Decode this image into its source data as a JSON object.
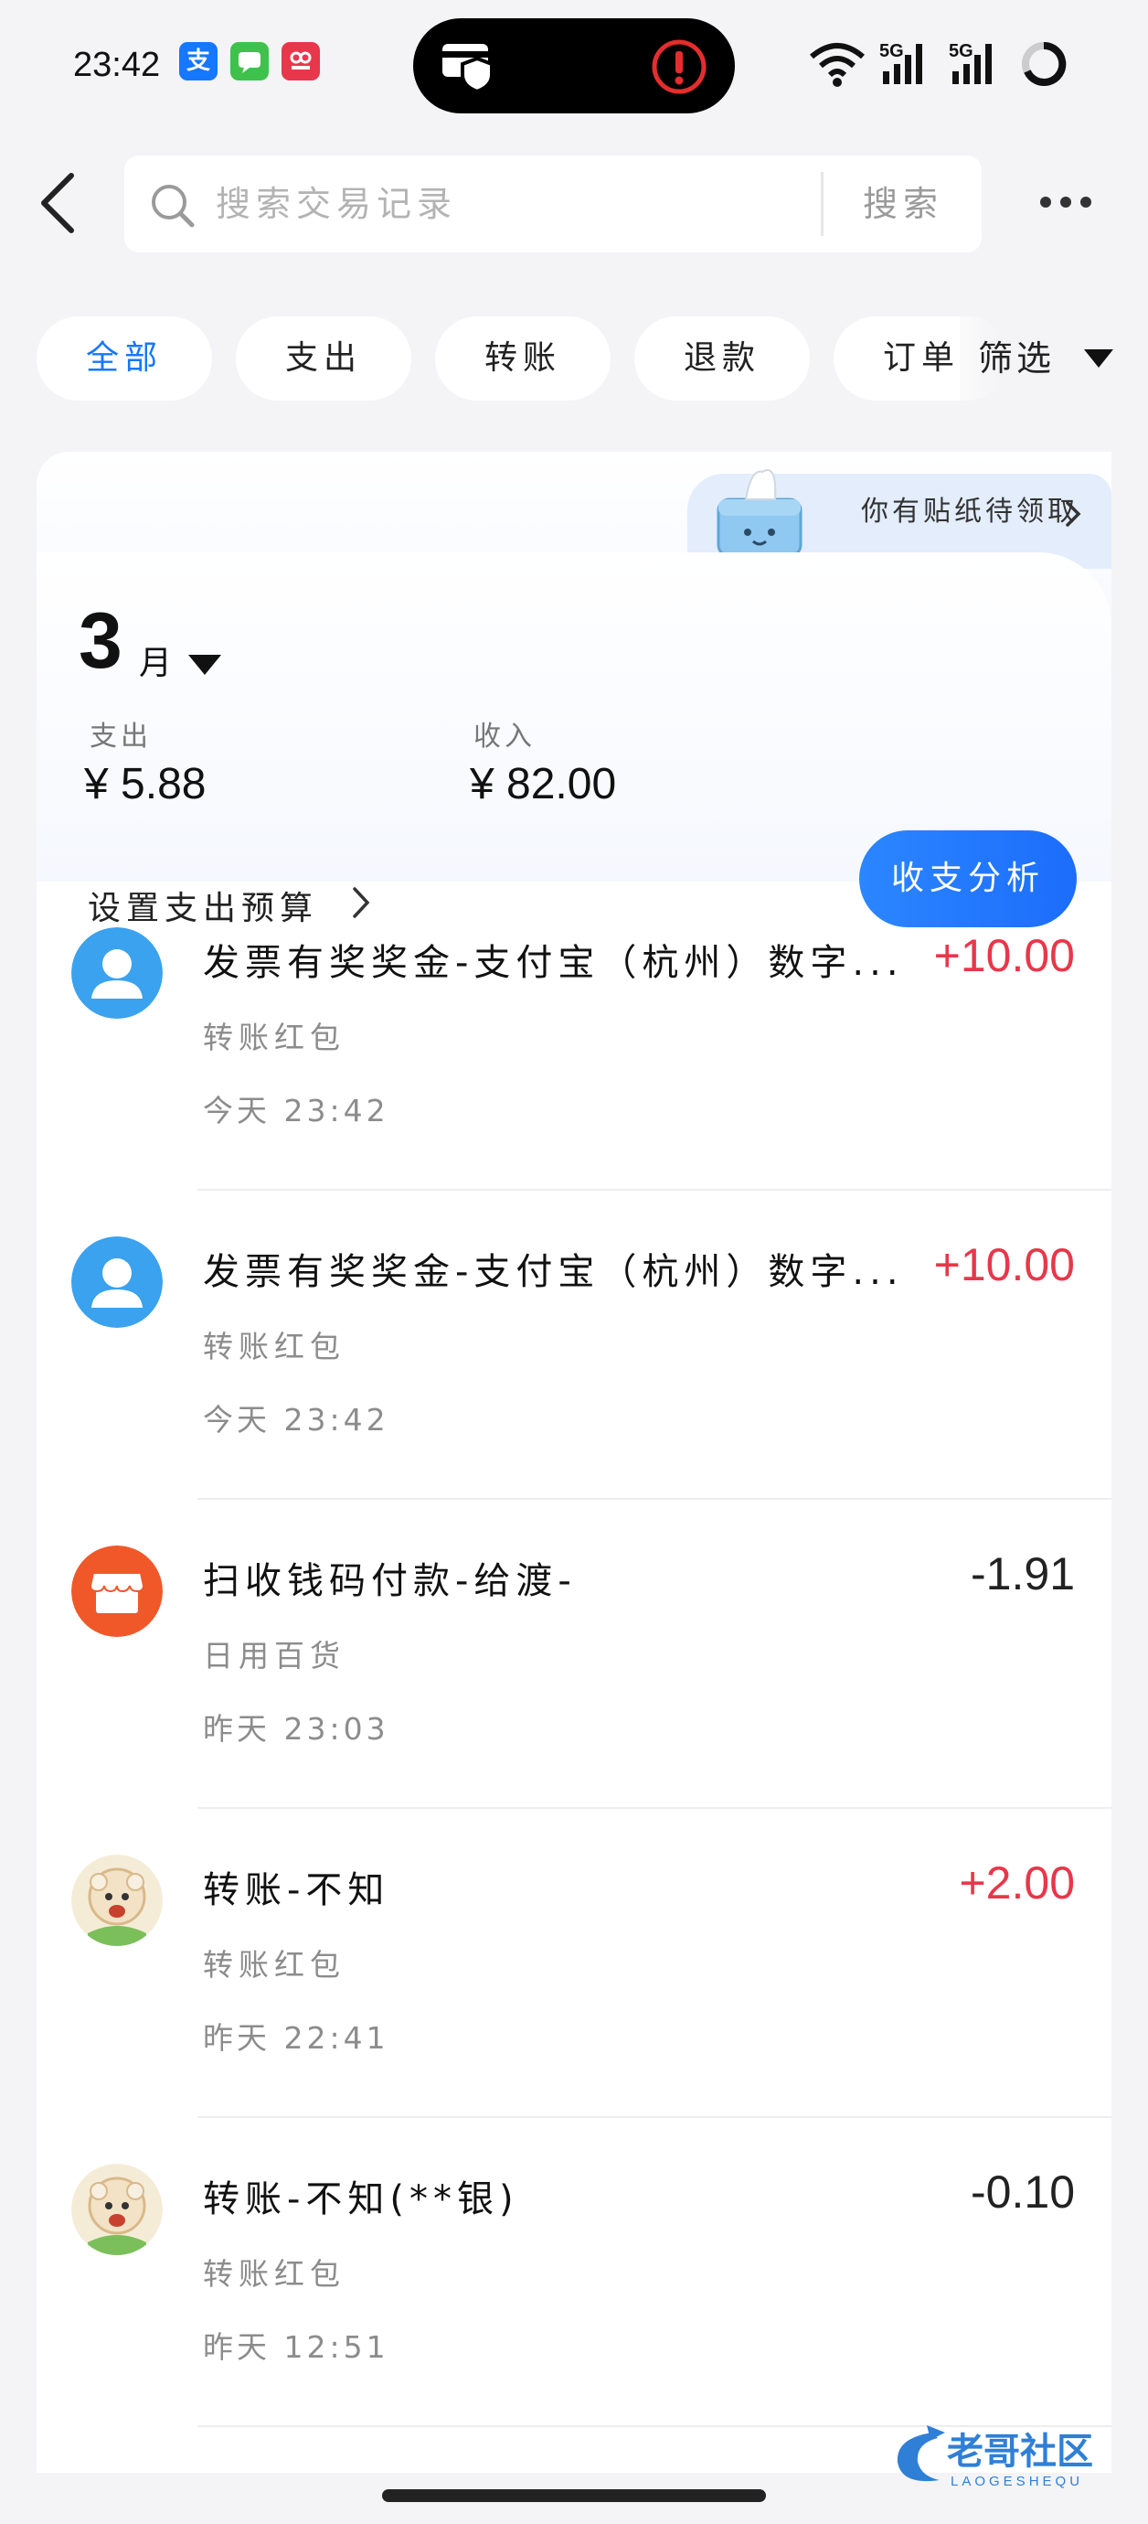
{
  "status_bar": {
    "time": "23:42",
    "apps": [
      {
        "icon": "alipay-app-icon",
        "glyph": "支",
        "color": "#1677ff"
      },
      {
        "icon": "messages-app-icon",
        "glyph": "",
        "color": "#3fc24b"
      },
      {
        "icon": "red-app-icon",
        "glyph": "",
        "color": "#e8374a"
      }
    ],
    "island_icons": [
      "card-shield-icon",
      "alert-icon"
    ],
    "right_icons": [
      "wifi-icon",
      "signal-5g-1-icon",
      "signal-5g-2-icon",
      "battery-ring-icon"
    ],
    "network": "5G"
  },
  "header": {
    "search_placeholder": "搜索交易记录",
    "search_button": "搜索"
  },
  "tabs": [
    {
      "label": "全部",
      "active": true
    },
    {
      "label": "支出",
      "active": false
    },
    {
      "label": "转账",
      "active": false
    },
    {
      "label": "退款",
      "active": false
    },
    {
      "label": "订单",
      "active": false
    }
  ],
  "filter_label": "筛选",
  "summary": {
    "month_number": "3",
    "month_unit": "月",
    "sticker_text": "你有贴纸待领取",
    "expense_label": "支出",
    "expense_value": "¥ 5.88",
    "income_label": "收入",
    "income_value": "¥ 82.00",
    "budget_label": "设置支出预算",
    "analysis_button": "收支分析"
  },
  "transactions": [
    {
      "avatar": "person-avatar",
      "title": "发票有奖奖金-支付宝（杭州）数字...",
      "category": "转账红包",
      "time": "今天 23:42",
      "amount": "+10.00",
      "sign": "pos"
    },
    {
      "avatar": "person-avatar",
      "title": "发票有奖奖金-支付宝（杭州）数字...",
      "category": "转账红包",
      "time": "今天 23:42",
      "amount": "+10.00",
      "sign": "pos"
    },
    {
      "avatar": "shop-avatar",
      "title": "扫收钱码付款-给渡-",
      "category": "日用百货",
      "time": "昨天 23:03",
      "amount": "-1.91",
      "sign": "neg"
    },
    {
      "avatar": "cartoon-avatar",
      "title": "转账-不知",
      "category": "转账红包",
      "time": "昨天 22:41",
      "amount": "+2.00",
      "sign": "pos"
    },
    {
      "avatar": "cartoon-avatar",
      "title": "转账-不知(**银)",
      "category": "转账红包",
      "time": "昨天 12:51",
      "amount": "-0.10",
      "sign": "neg"
    }
  ],
  "watermark_text": "老哥社区",
  "watermark_sub": "LAOGESHEQU",
  "colors": {
    "accent": "#1677ff",
    "income": "#e8374a",
    "background": "#f4f4f6"
  }
}
